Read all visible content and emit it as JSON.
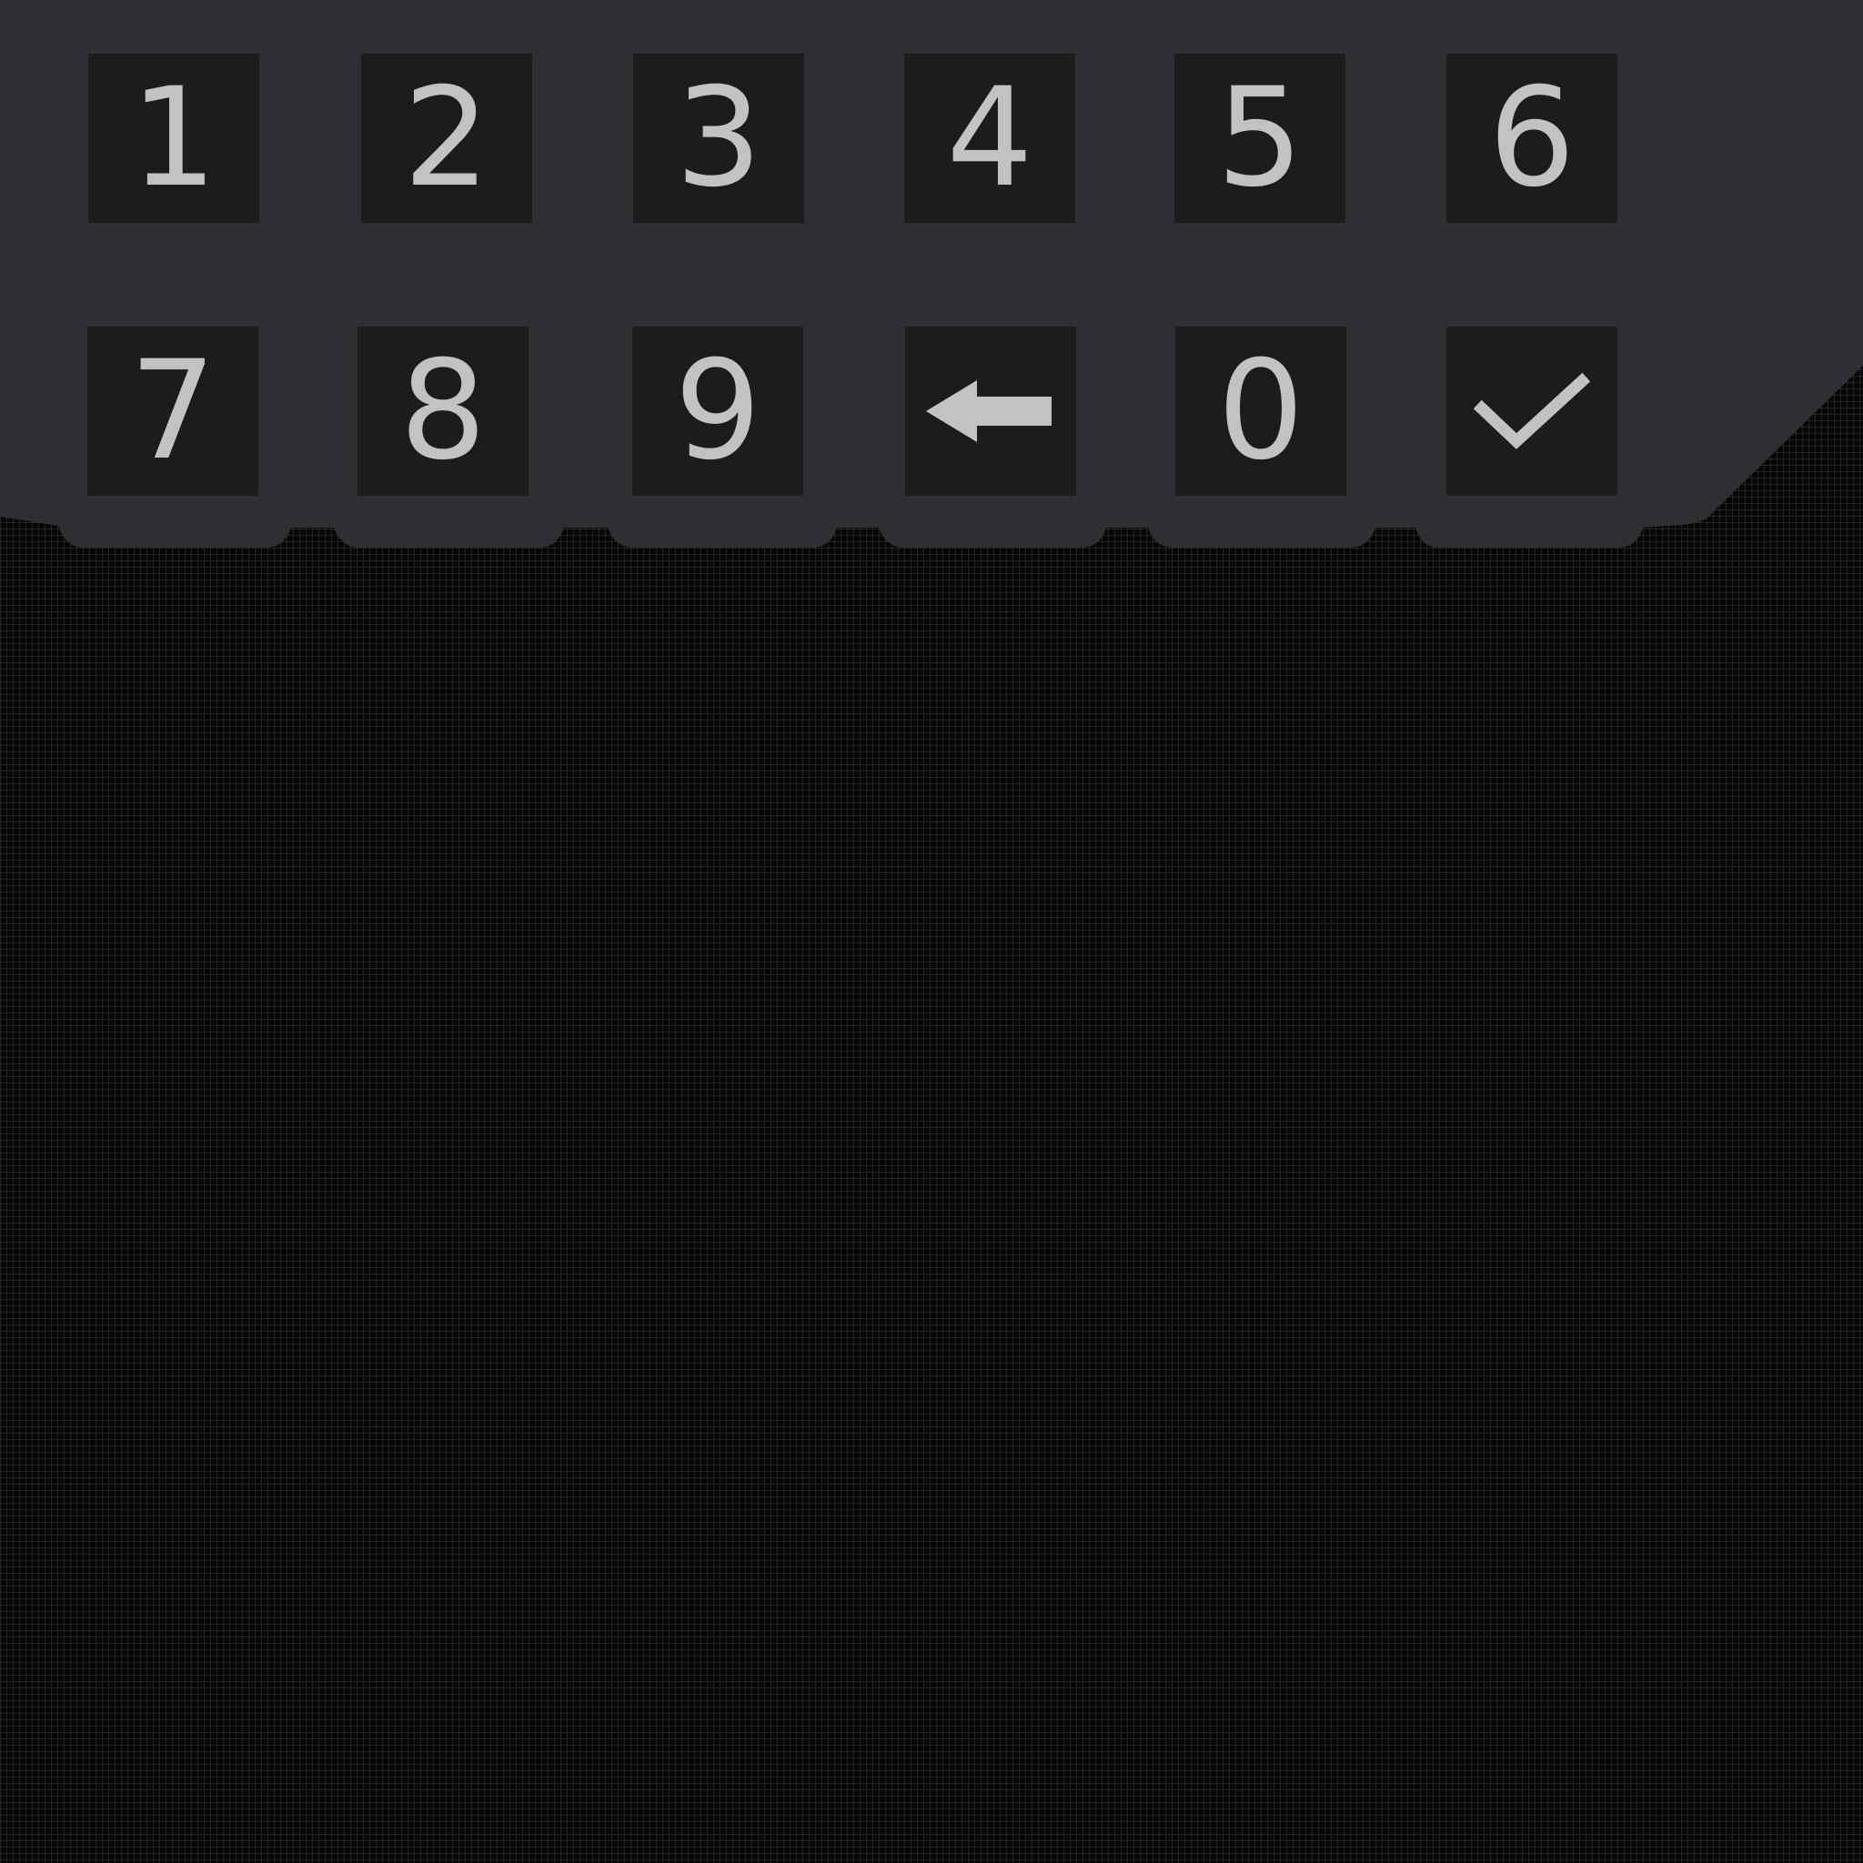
{
  "keypad": {
    "colors": {
      "panel": "#2f2e32",
      "key_background": "#1c1c1e",
      "glyph": "#c2c2c2",
      "background": "#050505",
      "grid": "#3e3e42"
    },
    "row1": [
      {
        "label": "1"
      },
      {
        "label": "2"
      },
      {
        "label": "3"
      },
      {
        "label": "4"
      },
      {
        "label": "5"
      },
      {
        "label": "6"
      }
    ],
    "row2": [
      {
        "label": "7"
      },
      {
        "label": "8"
      },
      {
        "label": "9"
      },
      {
        "icon": "backspace-arrow-icon"
      },
      {
        "label": "0"
      },
      {
        "icon": "checkmark-icon"
      }
    ]
  }
}
